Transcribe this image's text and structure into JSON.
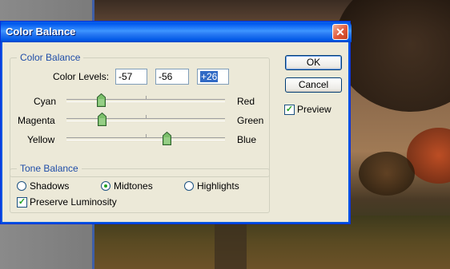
{
  "window": {
    "title": "Color Balance",
    "close_glyph": "✕"
  },
  "color_balance": {
    "legend": "Color Levels:",
    "group_title": "Color Balance",
    "levels": [
      "-57",
      "-56",
      "+26"
    ],
    "sliders": [
      {
        "left_label": "Cyan",
        "right_label": "Red",
        "value": -57,
        "min": -100,
        "max": 100
      },
      {
        "left_label": "Magenta",
        "right_label": "Green",
        "value": -56,
        "min": -100,
        "max": 100
      },
      {
        "left_label": "Yellow",
        "right_label": "Blue",
        "value": 26,
        "min": -100,
        "max": 100
      }
    ]
  },
  "tone_balance": {
    "group_title": "Tone Balance",
    "options": [
      {
        "label": "Shadows",
        "checked": false
      },
      {
        "label": "Midtones",
        "checked": true
      },
      {
        "label": "Highlights",
        "checked": false
      }
    ],
    "preserve_luminosity_label": "Preserve Luminosity",
    "preserve_luminosity_checked": true
  },
  "buttons": {
    "ok_label": "OK",
    "cancel_label": "Cancel"
  },
  "preview": {
    "label": "Preview",
    "checked": true
  },
  "colors": {
    "title_bar": "#0058ee",
    "group_title": "#1f4da8",
    "thumb_fill": "#7bbf6a"
  }
}
